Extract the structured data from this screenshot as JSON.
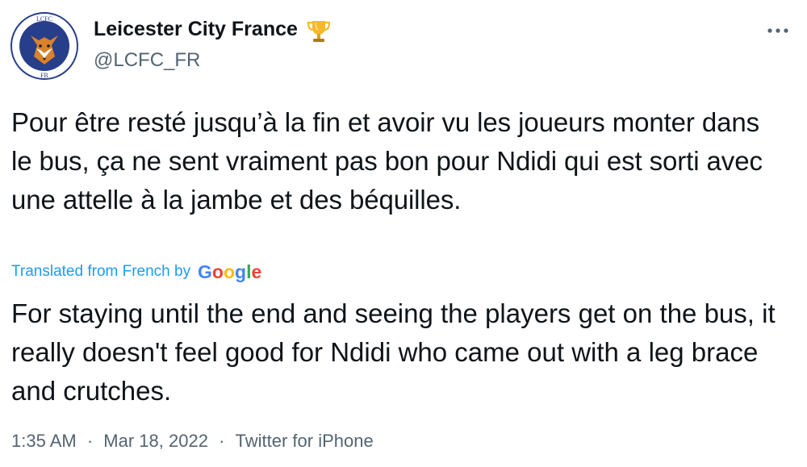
{
  "author": {
    "display_name": "Leicester City France",
    "handle": "@LCFC_FR",
    "avatar_icon": "lcfc-france-fox-crest-icon",
    "badge_icon": "trophy-icon",
    "avatar_text_top": "LCFC",
    "avatar_text_bottom": "FR"
  },
  "tweet": {
    "text": "Pour être resté jusqu’à la fin et avoir vu les joueurs monter dans le bus, ça ne sent vraiment pas bon pour Ndidi qui est sorti avec une attelle à la jambe et des béquilles.",
    "translated_label": "Translated from French by",
    "translator_logo_text": "Google",
    "translation": "For staying until the end and seeing the players get on the bus, it really doesn't feel good for Ndidi who came out with a leg brace and crutches."
  },
  "meta": {
    "time": "1:35 AM",
    "separator": "·",
    "date": "Mar 18, 2022",
    "source": "Twitter for iPhone"
  },
  "colors": {
    "text_primary": "#0f1419",
    "text_secondary": "#536471",
    "link_blue": "#1d9bf0",
    "crest_blue": "#273e8a",
    "trophy_gold": "#f5b82e"
  },
  "icons": {
    "more": "more-horizontal-icon"
  }
}
